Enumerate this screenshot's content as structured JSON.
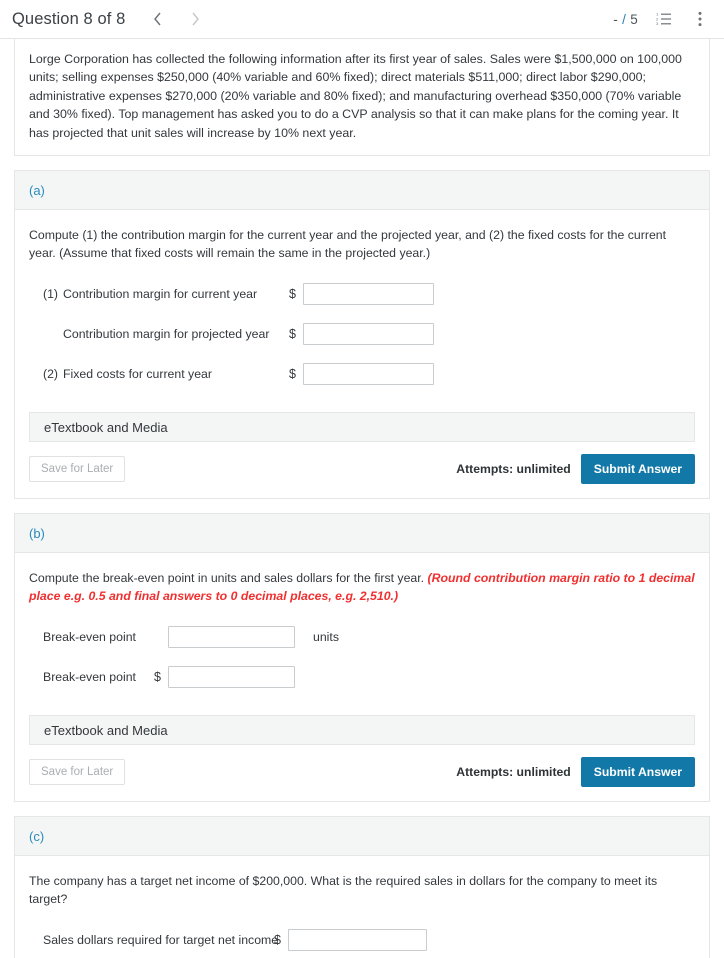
{
  "header": {
    "title": "Question 8 of 8",
    "prev_icon": "chevron-left-icon",
    "next_icon": "chevron-right-icon",
    "score": "- / 5",
    "score_earned": "-",
    "score_total": "5",
    "list_icon": "numbered-list-icon",
    "more_icon": "kebab-menu-icon",
    "accent_color": "#2a7fb5"
  },
  "prompt": {
    "text": "Lorge Corporation has collected the following information after its first year of sales. Sales were $1,500,000 on 100,000 units; selling expenses $250,000 (40% variable and 60% fixed); direct materials $511,000; direct labor $290,000; administrative expenses $270,000 (20% variable and 80% fixed); and manufacturing overhead $350,000 (70% variable and 30% fixed). Top management has asked you to do a CVP analysis so that it can make plans for the coming year. It has projected that unit sales will increase by 10% next year."
  },
  "common": {
    "etextbook_label": "eTextbook and Media",
    "save_for_later_label": "Save for Later",
    "attempts_label": "Attempts: unlimited",
    "submit_label": "Submit Answer",
    "dollar_sign": "$",
    "submit_color": "#1278a8",
    "section_header_bg": "#f4f5f5",
    "section_letter_color": "#2a8bbc",
    "note_color": "#f03030"
  },
  "parts": [
    {
      "letter": "(a)",
      "instruction": "Compute (1) the contribution margin for the current year and the projected year, and (2) the fixed costs for the current year. (Assume that fixed costs will remain the same in the projected year.)",
      "note": "",
      "rows": [
        {
          "num": "(1)",
          "label": "Contribution margin for current year",
          "value": "",
          "unit": ""
        },
        {
          "num": "",
          "label": "Contribution margin for projected year",
          "value": "",
          "unit": ""
        },
        {
          "num": "(2)",
          "label": "Fixed costs for current year",
          "value": "",
          "unit": ""
        }
      ]
    },
    {
      "letter": "(b)",
      "instruction": "Compute the break-even point in units and sales dollars for the first year. ",
      "note": "(Round contribution margin ratio to 1 decimal place e.g. 0.5 and final answers to 0 decimal places, e.g. 2,510.)",
      "rows": [
        {
          "num": "",
          "label": "Break-even point",
          "value": "",
          "unit": "units"
        },
        {
          "num": "",
          "label": "Break-even point",
          "value": "",
          "unit": ""
        }
      ]
    },
    {
      "letter": "(c)",
      "instruction": "The company has a target net income of $200,000. What is the required sales in dollars for the company to meet its target?",
      "note": "",
      "rows": [
        {
          "num": "",
          "label": "Sales dollars required for target net income",
          "value": "",
          "unit": ""
        }
      ]
    }
  ]
}
